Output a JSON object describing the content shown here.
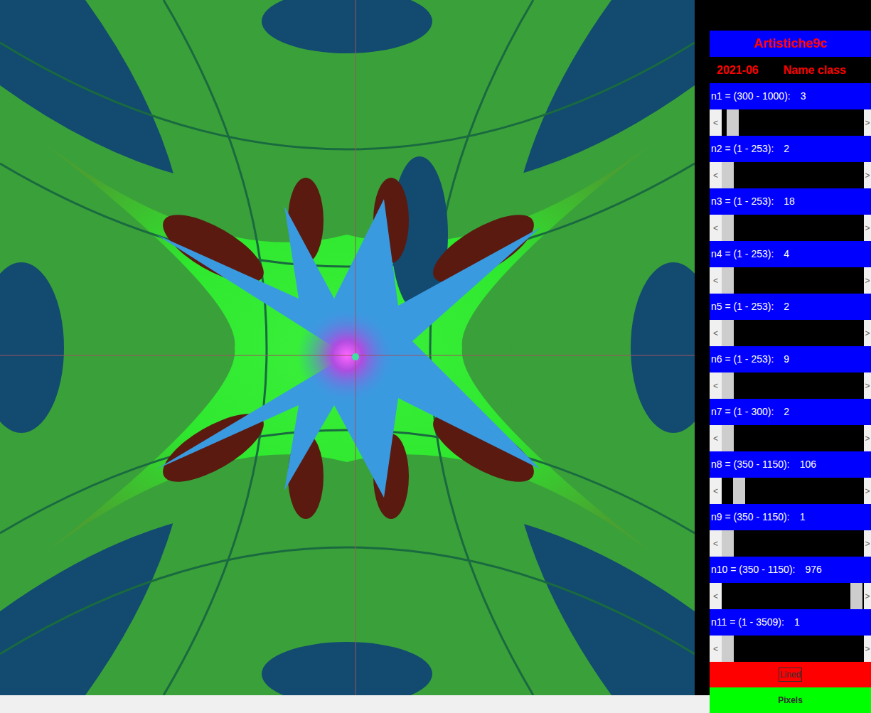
{
  "window": {
    "title": "Artistiche9c"
  },
  "header": {
    "date": "2021-06",
    "name": "Name class"
  },
  "scroll_arrows": {
    "left": "<",
    "right": ">"
  },
  "sliders": [
    {
      "label": "n1 = (300 - 1000):",
      "value": "3",
      "level": 0.04
    },
    {
      "label": "n2 = (1 - 253):",
      "value": "2",
      "level": 0.0
    },
    {
      "label": "n3 = (1 - 253):",
      "value": "18",
      "level": 0.0
    },
    {
      "label": "n4 = (1 - 253):",
      "value": "4",
      "level": 0.0
    },
    {
      "label": "n5 = (1 - 253):",
      "value": "2",
      "level": 0.0
    },
    {
      "label": "n6 = (1 - 253):",
      "value": "9",
      "level": 0.0
    },
    {
      "label": "n7 = (1 - 300):",
      "value": "2",
      "level": 0.0
    },
    {
      "label": "n8 = (350 - 1150):",
      "value": "106",
      "level": 0.09
    },
    {
      "label": "n9 = (350 - 1150):",
      "value": "1",
      "level": 0.0
    },
    {
      "label": "n10 = (350 - 1150):",
      "value": "976",
      "level": 0.99
    },
    {
      "label": "n11 = (1 - 3509):",
      "value": "1",
      "level": 0.0
    }
  ],
  "buttons": [
    {
      "label": "Lined",
      "color": "#ff0000",
      "focused": true
    },
    {
      "label": "Pixels",
      "color": "#00ff00",
      "focused": false
    }
  ]
}
